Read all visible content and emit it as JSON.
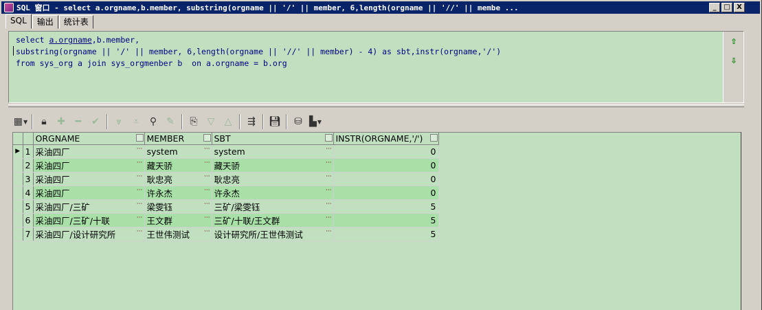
{
  "window": {
    "title": "SQL 窗口 - select a.orgname,b.member, substring(orgname || '/' || member, 6,length(orgname || '//' || membe ...",
    "minimize": "_",
    "maximize": "□",
    "close": "X"
  },
  "tabs": [
    {
      "label": "SQL"
    },
    {
      "label": "输出"
    },
    {
      "label": "统计表"
    }
  ],
  "editor": {
    "line1": {
      "a": "select ",
      "b": "a.orgname",
      "c": ",b.member,"
    },
    "line2": "substring(orgname || '/' || member, 6,length(orgname || '//' || member) - 4) as sbt,instr(orgname,'/')",
    "line3": "from sys_org a join sys_orgmenber b  on a.orgname = b.org"
  },
  "grid": {
    "columns": [
      "ORGNAME",
      "MEMBER",
      "SBT",
      "INSTR(ORGNAME,'/')"
    ],
    "rows": [
      {
        "n": "1",
        "orgname": "采油四厂",
        "member": "system",
        "sbt": "system",
        "instr": "0"
      },
      {
        "n": "2",
        "orgname": "采油四厂",
        "member": "藏天骄",
        "sbt": "藏天骄",
        "instr": "0"
      },
      {
        "n": "3",
        "orgname": "采油四厂",
        "member": "耿忠亮",
        "sbt": "耿忠亮",
        "instr": "0"
      },
      {
        "n": "4",
        "orgname": "采油四厂",
        "member": "许永杰",
        "sbt": "许永杰",
        "instr": "0"
      },
      {
        "n": "5",
        "orgname": "采油四厂/三矿",
        "member": "梁雯钰",
        "sbt": "三矿/梁雯钰",
        "instr": "5"
      },
      {
        "n": "6",
        "orgname": "采油四厂/三矿/十联",
        "member": "王文群",
        "sbt": "三矿/十联/王文群",
        "instr": "5"
      },
      {
        "n": "7",
        "orgname": "采油四厂/设计研究所",
        "member": "王世伟测试",
        "sbt": "设计研究所/王世伟测试",
        "instr": "5"
      }
    ],
    "ellipsis": "···"
  },
  "icons": [
    "grid-menu-icon",
    "lock-icon",
    "add-record-icon",
    "delete-record-icon",
    "post-icon",
    "fetch-next-icon",
    "fetch-last-icon",
    "find-icon",
    "clear-icon",
    "query-by-example-icon",
    "next-icon",
    "prev-icon",
    "single-record-view-icon",
    "save-icon",
    "export-icon",
    "chart-icon"
  ]
}
